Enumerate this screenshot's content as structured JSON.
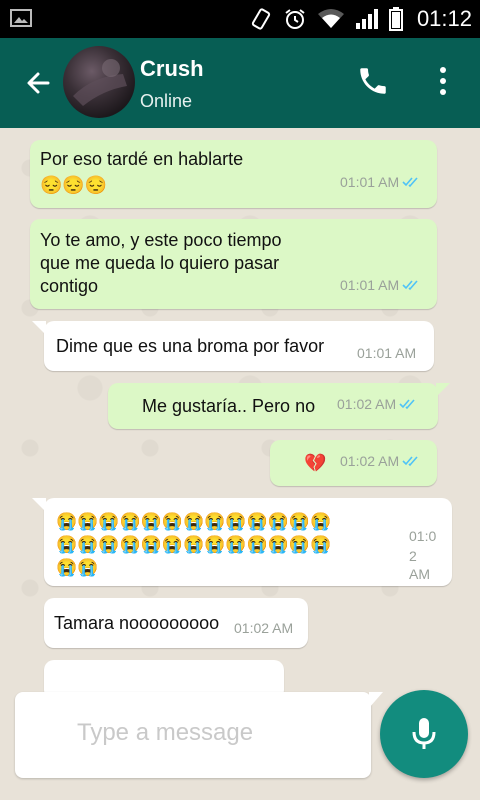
{
  "status_bar": {
    "time": "01:12"
  },
  "header": {
    "contact_name": "Crush",
    "contact_status": "Online"
  },
  "messages": [
    {
      "direction": "out",
      "text": "Por eso tardé en hablarte",
      "emoji_line": "😔😔😔",
      "time": "01:01 AM",
      "read": true
    },
    {
      "direction": "out",
      "lines": [
        "Yo te amo, y este poco tiempo",
        "que me queda lo quiero pasar",
        "contigo"
      ],
      "time": "01:01 AM",
      "read": true
    },
    {
      "direction": "in",
      "text": "Dime que es una broma por favor",
      "time": "01:01 AM"
    },
    {
      "direction": "out",
      "text": "Me gustaría.. Pero no",
      "time": "01:02 AM",
      "read": true
    },
    {
      "direction": "out",
      "text": "💔",
      "time": "01:02 AM",
      "read": true
    },
    {
      "direction": "in",
      "emoji_lines": [
        "😭😭😭😭😭😭😭😭😭😭😭😭😭",
        "😭😭😭😭😭😭😭😭😭😭😭😭😭",
        "😭😭"
      ],
      "time_lines": [
        "01:0",
        "2",
        "AM"
      ]
    },
    {
      "direction": "in",
      "text": "Tamara nooooooooo",
      "time": "01:02 AM"
    }
  ],
  "composer": {
    "placeholder": "Type a message"
  },
  "colors": {
    "header": "#075e54",
    "outgoing_bubble": "#dcf8c6",
    "incoming_bubble": "#ffffff",
    "mic_button": "#128c7e",
    "read_ticks": "#4fc3f7"
  }
}
